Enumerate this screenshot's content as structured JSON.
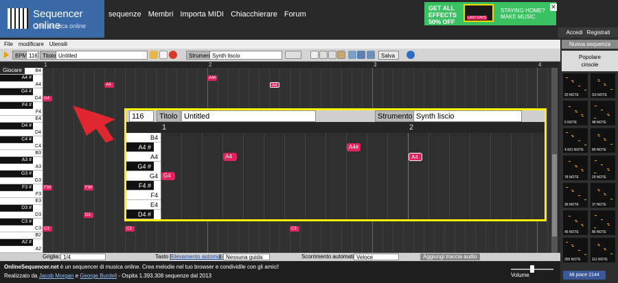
{
  "header": {
    "title": "Sequencer online",
    "subtitle": "Crea musica online",
    "nav": [
      "sequenze",
      "Membri",
      "Importa MIDI",
      "Chiacchierare",
      "Forum"
    ],
    "ad_left": "GET ALL EFFECTS 50% OFF",
    "ad_badge": "LAST DAYS",
    "ad_right": "STAYING HOME? MAKE MUSIC",
    "auth": [
      "Accedi",
      "Registrati"
    ]
  },
  "menu": [
    "File",
    "modificare",
    "Utensili"
  ],
  "toolbar": {
    "bpm_label": "BPM",
    "bpm_value": "116",
    "title_label": "Titolo",
    "title_value": "Untitled",
    "instrument_label": "Strumento",
    "instrument_value": "Synth liscio",
    "save_label": "Salva"
  },
  "grid": {
    "play_label": "Giocare",
    "bars": [
      "1",
      "2",
      "3",
      "4"
    ],
    "keys": [
      {
        "n": "B4",
        "b": false
      },
      {
        "n": "A4#",
        "b": true
      },
      {
        "n": "A4",
        "b": false
      },
      {
        "n": "G4#",
        "b": true
      },
      {
        "n": "G4",
        "b": false
      },
      {
        "n": "F4#",
        "b": true
      },
      {
        "n": "F4",
        "b": false
      },
      {
        "n": "E4",
        "b": false
      },
      {
        "n": "D4#",
        "b": true
      },
      {
        "n": "D4",
        "b": false
      },
      {
        "n": "C4#",
        "b": true
      },
      {
        "n": "C4",
        "b": false
      },
      {
        "n": "B3",
        "b": false
      },
      {
        "n": "A3#",
        "b": true
      },
      {
        "n": "A3",
        "b": false
      },
      {
        "n": "G3#",
        "b": true
      },
      {
        "n": "G3",
        "b": false
      },
      {
        "n": "F3#",
        "b": true
      },
      {
        "n": "F3",
        "b": false
      },
      {
        "n": "E3",
        "b": false
      },
      {
        "n": "D3#",
        "b": true
      },
      {
        "n": "D3",
        "b": false
      },
      {
        "n": "C3#",
        "b": true
      },
      {
        "n": "C3",
        "b": false
      },
      {
        "n": "B2",
        "b": false
      },
      {
        "n": "A2#",
        "b": true
      },
      {
        "n": "A2",
        "b": false
      }
    ],
    "notes": [
      {
        "label": "A4",
        "key": 2,
        "beat": 6
      },
      {
        "label": "A4#",
        "key": 1,
        "beat": 16
      },
      {
        "label": "G4",
        "key": 4,
        "beat": 0
      },
      {
        "label": "F3#",
        "key": 17,
        "beat": 0
      },
      {
        "label": "F3#",
        "key": 17,
        "beat": 4
      },
      {
        "label": "D3",
        "key": 21,
        "beat": 4
      },
      {
        "label": "C3",
        "key": 23,
        "beat": 0
      },
      {
        "label": "C3",
        "key": 23,
        "beat": 8
      },
      {
        "label": "C3",
        "key": 23,
        "beat": 24
      }
    ],
    "highlight_note": {
      "label": "A4",
      "key": 2,
      "beat": 22
    }
  },
  "bottom": {
    "grid_label": "Griglia:",
    "grid_value": "1/4",
    "key_label": "Tasto (",
    "key_link": "Rilevamento automatico",
    "key_end": ")",
    "guide_value": "Nessuna guida ai",
    "scroll_label": "Scorrimento automatico:",
    "scroll_value": "Veloce",
    "add_track": "Aggiungi traccia audio"
  },
  "footer": {
    "line1_site": "OnlineSequencer.net",
    "line1_rest": " è un sequencer di musica online. Crea melodie nel tuo browser e condividile con gli amici!",
    "line2_pre": "Realizzato da ",
    "author1": "Jacob Morgan",
    "line2_and": " e ",
    "author2": "George Burdell",
    "line2_post": " - Ospita 1.393.308 sequenze dal 2013",
    "volume": "Volume",
    "like": "Mi piace 2144"
  },
  "sidebar": {
    "new_seq": "Nuova sequenza",
    "popular": "Popolare",
    "popular_sub": "cinsole",
    "thumbs": [
      "20 NOTE",
      "SS NOTE",
      "6 NOTE",
      "48 NOTE",
      "4.931 NOTE",
      "89 NOTE",
      "78 NOTE",
      "29 NOTE",
      "36 NOTE",
      "37 NOTE",
      "45 NOTE",
      "86 NOTE",
      "355 NOTE",
      "111 NOTE"
    ]
  },
  "zoom": {
    "bpm": "116",
    "title_label": "Titolo",
    "title_value": "Untitled",
    "instrument_label": "Strumento",
    "instrument_value": "Synth liscio",
    "bars": [
      "1",
      "2"
    ],
    "keys": [
      {
        "n": "B4",
        "b": false
      },
      {
        "n": "A4#",
        "b": true
      },
      {
        "n": "A4",
        "b": false
      },
      {
        "n": "G4#",
        "b": true
      },
      {
        "n": "G4",
        "b": false
      },
      {
        "n": "F4#",
        "b": true
      },
      {
        "n": "F4",
        "b": false
      },
      {
        "n": "E4",
        "b": false
      },
      {
        "n": "D4#",
        "b": true
      }
    ],
    "notes": [
      {
        "label": "A4",
        "key": 2,
        "col": 3
      },
      {
        "label": "A4#",
        "key": 1,
        "col": 9
      },
      {
        "label": "G4",
        "key": 4,
        "col": 0
      }
    ],
    "highlight": {
      "label": "A4",
      "key": 2,
      "col": 12
    }
  },
  "colors": {
    "note": "#e0245e",
    "zoom_border": "#fff200",
    "header_blue": "#3b6aa8"
  }
}
